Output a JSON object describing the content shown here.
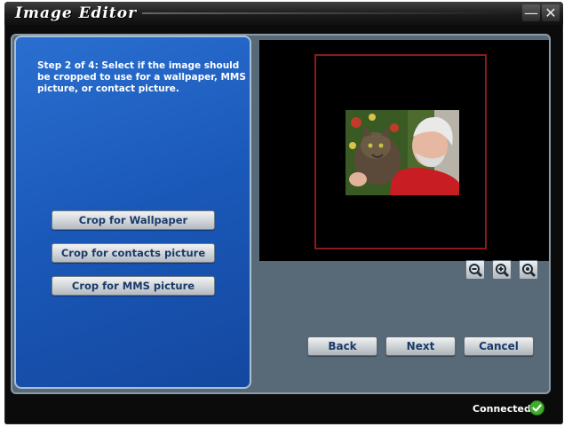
{
  "window": {
    "title": "Image Editor",
    "minimize_glyph": "—",
    "close_glyph": "✕"
  },
  "left_panel": {
    "step_text": "Step 2 of 4: Select if the image should be cropped to use for a wallpaper, MMS picture, or contact picture.",
    "buttons": {
      "wallpaper": "Crop for Wallpaper",
      "contacts": "Crop for contacts picture",
      "mms": "Crop for MMS picture"
    }
  },
  "preview": {
    "crop_frame_color": "#8b1a1a",
    "image_icon": "photo-of-man-with-cat"
  },
  "zoom": {
    "out_icon": "zoom-out-icon",
    "in_icon": "zoom-in-icon",
    "fit_icon": "zoom-fit-icon"
  },
  "nav": {
    "back": "Back",
    "next": "Next",
    "cancel": "Cancel"
  },
  "status": {
    "text": "Connected",
    "icon": "check-icon",
    "icon_color": "#3fae2a"
  },
  "colors": {
    "panel_blue": "#1a58b8",
    "frame_gray": "#586977",
    "window_bg": "#0b0b0b"
  }
}
